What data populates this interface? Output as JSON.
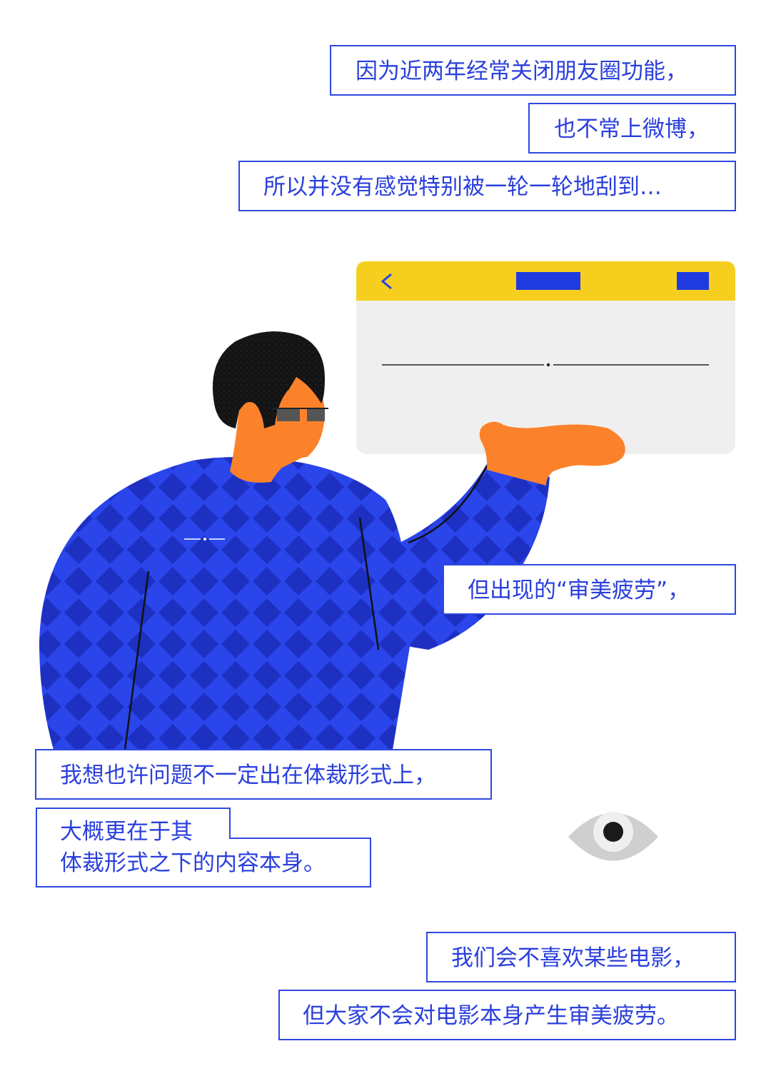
{
  "captions": {
    "c1": "因为近两年经常关闭朋友圈功能，",
    "c2": "也不常上微博，",
    "c3": "所以并没有感觉特别被一轮一轮地刮到…",
    "c4": "但出现的“审美疲劳”，",
    "c5": "我想也许问题不一定出在体裁形式上，",
    "c6_line1": "大概更在于其",
    "c6_line2": "体裁形式之下的内容本身。",
    "c7": "我们会不喜欢某些电影，",
    "c8": "但大家不会对电影本身产生审美疲劳。"
  },
  "illustration": {
    "icons": [
      "back-chevron-icon",
      "eye-icon",
      "sunglasses-icon"
    ],
    "colors": {
      "accent_blue": "#2a3fdc",
      "window_bar_yellow": "#f6cf1e",
      "window_body_gray": "#efefef",
      "skin_orange": "#fb822b",
      "hair_black": "#151515",
      "sweater_blue": "#2742e8",
      "sweater_dark_blue": "#1f33c4"
    }
  }
}
